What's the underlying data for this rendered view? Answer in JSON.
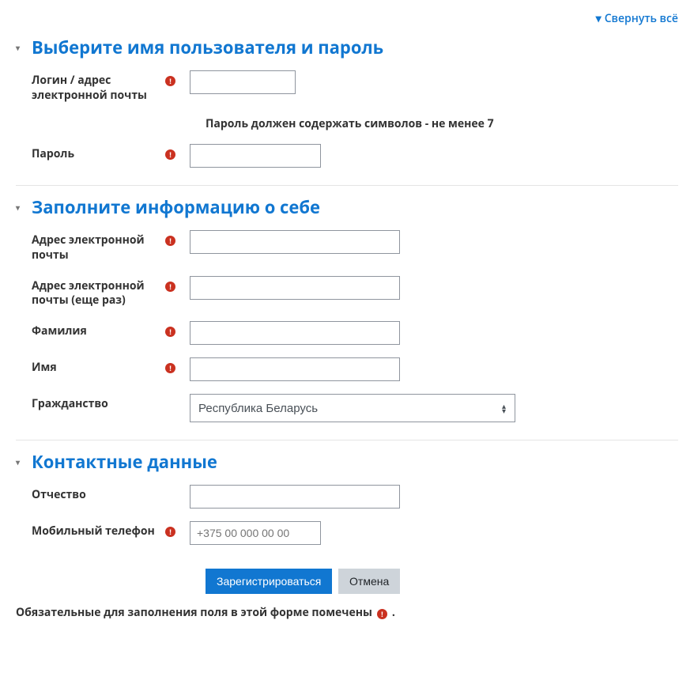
{
  "topbar": {
    "collapse_all": "Свернуть всё"
  },
  "sections": {
    "credentials": {
      "title": "Выберите имя пользователя и пароль",
      "login_label": "Логин / адрес электронной почты",
      "password_hint": "Пароль должен содержать символов - не менее 7",
      "password_label": "Пароль"
    },
    "about": {
      "title": "Заполните информацию о себе",
      "email_label": "Адрес электронной почты",
      "email2_label": "Адрес электронной почты (еще раз)",
      "lastname_label": "Фамилия",
      "firstname_label": "Имя",
      "citizenship_label": "Гражданство",
      "citizenship_value": "Республика Беларусь"
    },
    "contact": {
      "title": "Контактные данные",
      "patronymic_label": "Отчество",
      "mobile_label": "Мобильный телефон",
      "mobile_placeholder": "+375 00 000 00 00"
    }
  },
  "buttons": {
    "submit": "Зарегистрироваться",
    "cancel": "Отмена"
  },
  "footnote": {
    "text_before": "Обязательные для заполнения поля в этой форме помечены",
    "text_after": "."
  }
}
